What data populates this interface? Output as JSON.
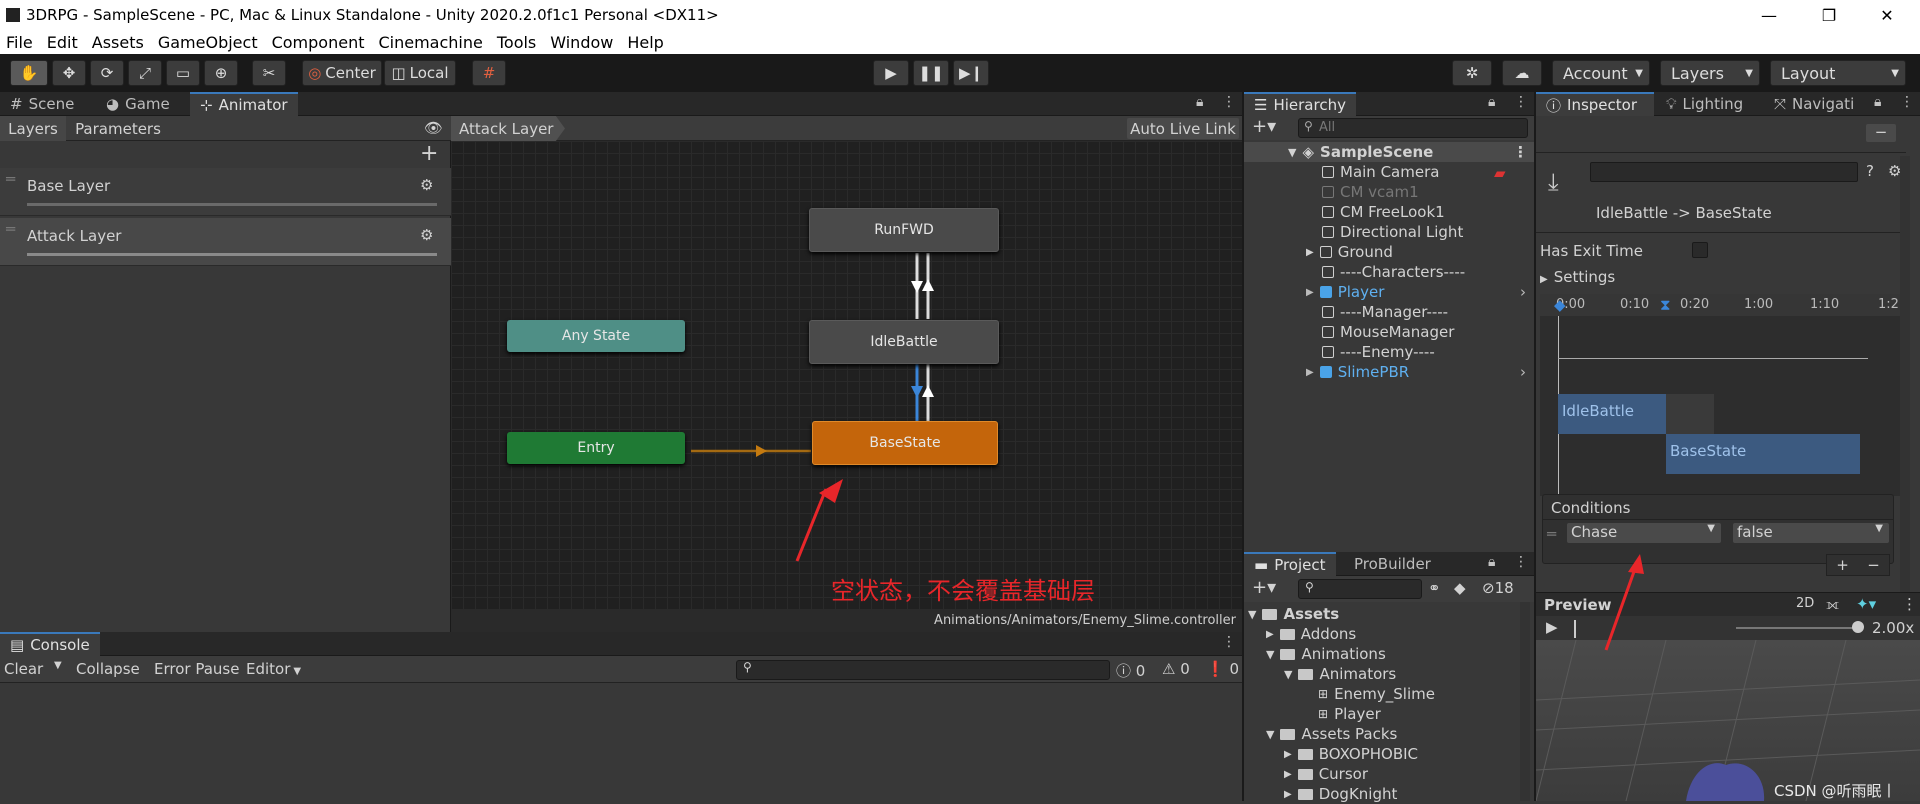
{
  "window": {
    "title": "3DRPG - SampleScene - PC, Mac & Linux Standalone - Unity 2020.2.0f1c1 Personal <DX11>",
    "minimize": "—",
    "maximize": "❐",
    "close": "✕"
  },
  "menu": [
    "File",
    "Edit",
    "Assets",
    "GameObject",
    "Component",
    "Cinemachine",
    "Tools",
    "Window",
    "Help"
  ],
  "toolbar": {
    "pivot": "Center",
    "space": "Local",
    "account": "Account",
    "layers": "Layers",
    "layout": "Layout"
  },
  "scene_tabs": [
    "Scene",
    "Game",
    "Animator"
  ],
  "animator": {
    "subtabs": [
      "Layers",
      "Parameters"
    ],
    "layers": [
      "Base Layer",
      "Attack Layer"
    ],
    "breadcrumb": "Attack Layer",
    "live_link": "Auto Live Link",
    "path": "Animations/Animators/Enemy_Slime.controller",
    "nodes": {
      "runfwd": "RunFWD",
      "idle": "IdleBattle",
      "any": "Any State",
      "entry": "Entry",
      "base": "BaseState"
    },
    "annotation": "空状态，不会覆盖基础层"
  },
  "hierarchy": {
    "tab": "Hierarchy",
    "search_placeholder": "All",
    "scene": "SampleScene",
    "items": [
      {
        "label": "Main Camera",
        "style": "normal"
      },
      {
        "label": "CM vcam1",
        "style": "dim"
      },
      {
        "label": "CM FreeLook1",
        "style": "normal"
      },
      {
        "label": "Directional Light",
        "style": "normal"
      },
      {
        "label": "Ground",
        "style": "normal"
      },
      {
        "label": "----Characters----",
        "style": "normal"
      },
      {
        "label": "Player",
        "style": "blue"
      },
      {
        "label": "----Manager----",
        "style": "normal"
      },
      {
        "label": "MouseManager",
        "style": "normal"
      },
      {
        "label": "----Enemy----",
        "style": "normal"
      },
      {
        "label": "SlimePBR",
        "style": "blue"
      }
    ]
  },
  "inspector": {
    "tabs": [
      "Inspector",
      "Lighting",
      "Navigati"
    ],
    "transition": "IdleBattle -> BaseState",
    "has_exit_time": "Has Exit Time",
    "settings": "Settings",
    "timeline_ticks": [
      "0:00",
      "0:10",
      "0:20",
      "1:00",
      "1:10",
      "1:2"
    ],
    "clip_from": "IdleBattle",
    "clip_to": "BaseState",
    "conditions_label": "Conditions",
    "condition_param": "Chase",
    "condition_value": "false",
    "preview": "Preview",
    "preview_2d": "2D",
    "speed": "2.00x",
    "watermark": "CSDN @听雨眠丨"
  },
  "console": {
    "tab": "Console",
    "clear": "Clear",
    "collapse": "Collapse",
    "error_pause": "Error Pause",
    "editor": "Editor",
    "count_info": "0",
    "count_warn": "0",
    "count_err": "0"
  },
  "project": {
    "tabs": [
      "Project",
      "ProBuilder"
    ],
    "hidden_count": "18",
    "items": [
      {
        "label": "Assets",
        "indent": 0,
        "bold": true,
        "arrow": "▼",
        "type": "folder"
      },
      {
        "label": "Addons",
        "indent": 1,
        "arrow": "▶",
        "type": "folder"
      },
      {
        "label": "Animations",
        "indent": 1,
        "arrow": "▼",
        "type": "folder"
      },
      {
        "label": "Animators",
        "indent": 2,
        "arrow": "▼",
        "type": "folder"
      },
      {
        "label": "Enemy_Slime",
        "indent": 3,
        "arrow": "",
        "type": "controller"
      },
      {
        "label": "Player",
        "indent": 3,
        "arrow": "",
        "type": "controller"
      },
      {
        "label": "Assets Packs",
        "indent": 1,
        "arrow": "▼",
        "type": "folder"
      },
      {
        "label": "BOXOPHOBIC",
        "indent": 2,
        "arrow": "▶",
        "type": "folder"
      },
      {
        "label": "Cursor",
        "indent": 2,
        "arrow": "▶",
        "type": "folder"
      },
      {
        "label": "DogKnight",
        "indent": 2,
        "arrow": "▶",
        "type": "folder"
      }
    ]
  },
  "colors": {
    "accent": "#3a79bb",
    "base_state": "#c4650b",
    "entry": "#1f7a34",
    "any_state": "#4f8f86",
    "annotation": "#e8262a"
  }
}
